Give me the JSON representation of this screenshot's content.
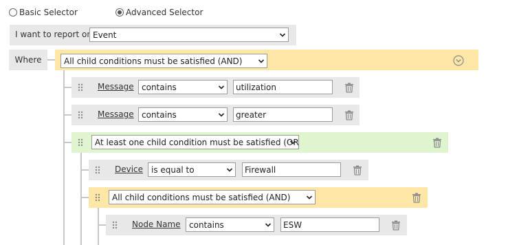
{
  "selector_mode": {
    "basic_label": "Basic Selector",
    "advanced_label": "Advanced Selector",
    "selected": "Advanced Selector"
  },
  "report_on": {
    "label": "I want to report on",
    "value": "Event"
  },
  "where": {
    "label": "Where",
    "root_group_value": "All child conditions must be satisfied (AND)",
    "conditions": [
      {
        "field": "Message",
        "operator": "contains",
        "value": "utilization"
      },
      {
        "field": "Message",
        "operator": "contains",
        "value": "greater"
      }
    ],
    "or_group": {
      "value": "At least one child condition must be satisfied (OR)",
      "condition": {
        "field": "Device",
        "operator": "is equal to",
        "value": "Firewall"
      },
      "and_group": {
        "value": "All child conditions must be satisfied (AND)",
        "condition": {
          "field": "Node Name",
          "operator": "contains",
          "value": "ESW"
        }
      }
    }
  },
  "icons": {
    "trash": "trash-icon",
    "grip": "drag-handle-icon",
    "collapse": "chevron-circle-down-icon",
    "dropdown": "chevron-down-icon"
  },
  "colors": {
    "and_group": "#fde6a6",
    "or_group": "#dff5d0",
    "condition_row": "#e8e8e8"
  }
}
